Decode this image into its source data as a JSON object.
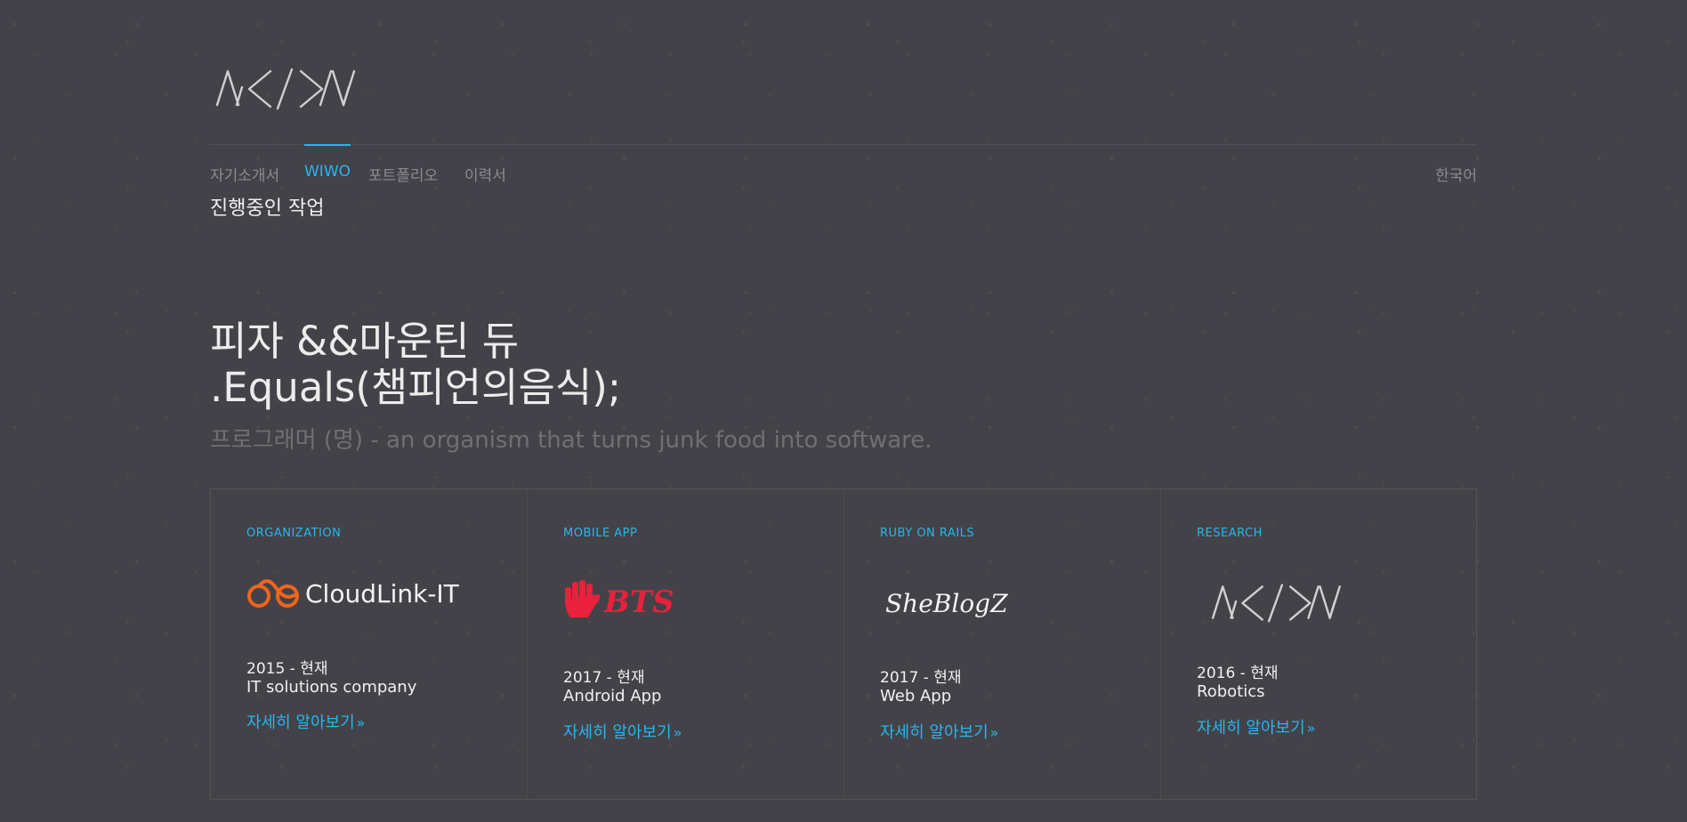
{
  "brand": {
    "logo_icon": "nxn-logo-icon"
  },
  "nav": {
    "items": [
      {
        "label": "자기소개서",
        "active": false
      },
      {
        "label": "WIWO",
        "active": true
      },
      {
        "label": "포트폴리오",
        "active": false
      },
      {
        "label": "이력서",
        "active": false
      }
    ],
    "language": "한국어"
  },
  "page": {
    "subtitle": "진행중인 작업",
    "hero_line1": "피자 &&마운틴 듀",
    "hero_line2": ".Equals(챔피언의음식);",
    "hero_sub": "프로그래머 (명) - an organism that turns junk food into software."
  },
  "cards": [
    {
      "category": "ORGANIZATION",
      "logo": "cloudlink-it-logo",
      "logo_text": "CloudLink-IT",
      "year": "2015 - 현재",
      "desc": "IT solutions company",
      "link": "자세히 알아보기"
    },
    {
      "category": "MOBILE APP",
      "logo": "bts-hand-logo",
      "logo_text": "BTS",
      "year": "2017 - 현재",
      "desc": "Android App",
      "link": "자세히 알아보기"
    },
    {
      "category": "RUBY ON RAILS",
      "logo": "sheblogz-logo",
      "logo_text": "SheBlogZ",
      "year": "2017 - 현재",
      "desc": "Web App",
      "link": "자세히 알아보기"
    },
    {
      "category": "RESEARCH",
      "logo": "nxn-logo-icon",
      "year": "2016 - 현재",
      "desc": "Robotics",
      "link": "자세히 알아보기"
    }
  ],
  "colors": {
    "background": "#434248",
    "accent": "#27b6ee",
    "cloud_orange": "#f0641e",
    "bts_red": "#e8213c"
  }
}
